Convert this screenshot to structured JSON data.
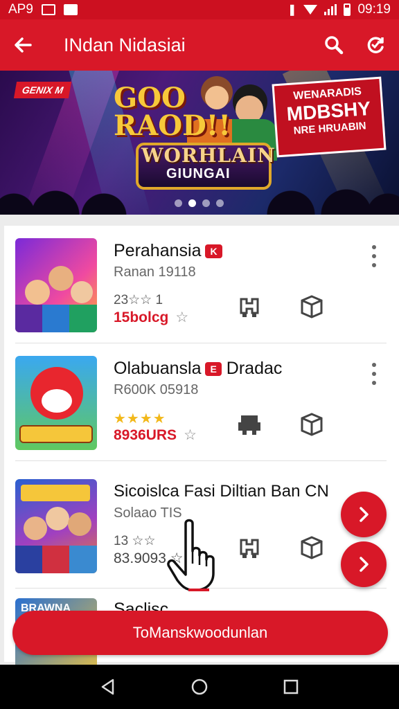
{
  "status_bar": {
    "left_text": "AP9",
    "time": "09:19"
  },
  "app_bar": {
    "title": "INdan Nidasiai",
    "back_icon": "arrow-back-icon",
    "search_icon": "search-icon",
    "refresh_icon": "refresh-icon"
  },
  "banner": {
    "tag": "GENIX M",
    "headline": "GOO RAOD!!",
    "subtitle1": "WORHLAIN",
    "subtitle2": "GIUNGAI",
    "promo_line1": "WENARADIS",
    "promo_line2": "MDBSHY",
    "promo_line3": "NRE HRUABIN",
    "pages": 4,
    "active_page": 2
  },
  "apps": [
    {
      "name": "Perahansia",
      "badge": "K",
      "meta": "Ranan 19118",
      "rating_text": "23☆☆ 1",
      "stars_shown": "",
      "price": "15bolcg",
      "icon1": "controller-icon",
      "icon2": "box-icon"
    },
    {
      "name": "Olabuansla",
      "badge": "E",
      "name_suffix": "Dradac",
      "meta": "R600K 05918",
      "rating_text": "",
      "stars_shown": "★★★★",
      "price": "8936URS",
      "icon1": "printer-icon",
      "icon2": "box-icon"
    },
    {
      "name": "Sicoislca Fasi Diltian Ban CN",
      "badge": "",
      "meta": "Solaao TIS",
      "rating_text": "13 ☆☆",
      "stars_shown": "",
      "price": "83.9093 ☆",
      "icon1": "controller-icon",
      "icon2": "box-icon"
    }
  ],
  "partial_item": {
    "name": "Saclisc",
    "thumb_text": "BRAWNA"
  },
  "cta": {
    "label": "ToManskwoodunlan"
  },
  "colors": {
    "primary": "#d81828",
    "status": "#cc1020"
  }
}
